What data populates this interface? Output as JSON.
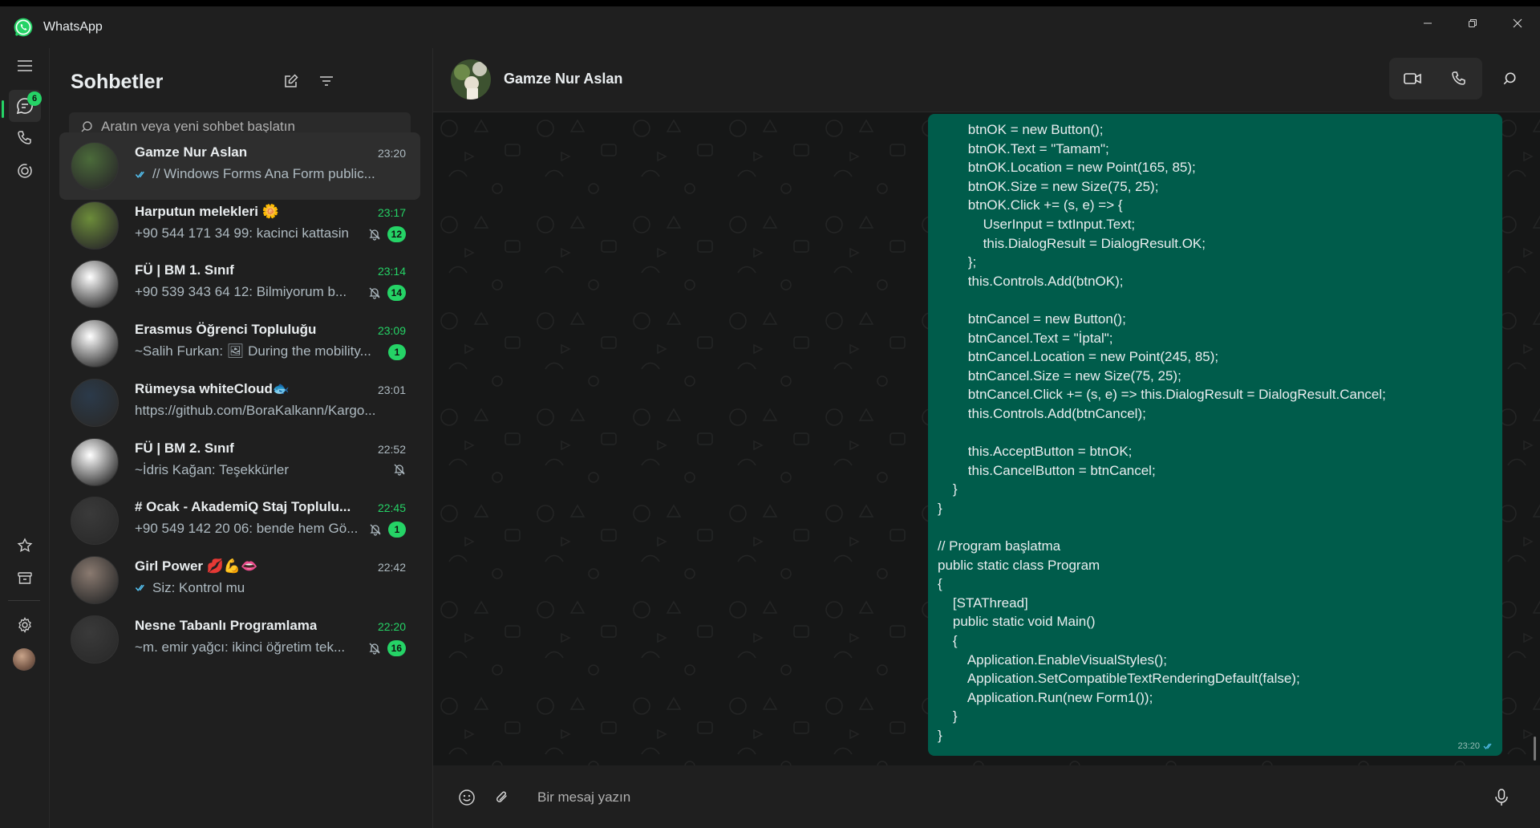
{
  "window": {
    "title": "WhatsApp"
  },
  "rail": {
    "chats_badge": "6"
  },
  "chatlist": {
    "title": "Sohbetler",
    "search_placeholder": "Aratın veya yeni sohbet başlatın",
    "items": [
      {
        "name": "Gamze Nur Aslan",
        "time": "23:20",
        "preview": "// Windows Forms Ana Form public...",
        "read_ticks": true,
        "unread": "",
        "muted": false,
        "time_unread": false,
        "avatar_color": "#4b6b3a"
      },
      {
        "name": "Harputun melekleri 🌼",
        "time": "23:17",
        "preview": "+90 544 171 34 99: kacinci kattasin",
        "read_ticks": false,
        "unread": "12",
        "muted": true,
        "time_unread": true,
        "avatar_color": "#6c8c3a"
      },
      {
        "name": "FÜ | BM 1. Sınıf",
        "time": "23:14",
        "preview": "+90 539 343 64 12: Bilmiyorum b...",
        "read_ticks": false,
        "unread": "14",
        "muted": true,
        "time_unread": true,
        "avatar_color": "#ffffff"
      },
      {
        "name": "Erasmus Öğrenci Topluluğu",
        "time": "23:09",
        "preview": "~Salih Furkan: 🖼 During the mobility...",
        "read_ticks": false,
        "unread": "1",
        "muted": false,
        "time_unread": true,
        "avatar_color": "#ffffff"
      },
      {
        "name": "Rümeysa whiteCloud🐟",
        "time": "23:01",
        "preview": "https://github.com/BoraKalkann/Kargo...",
        "read_ticks": false,
        "unread": "",
        "muted": false,
        "time_unread": false,
        "avatar_color": "#2b3a4a"
      },
      {
        "name": "FÜ | BM 2. Sınıf",
        "time": "22:52",
        "preview": "~İdris Kağan: Teşekkürler",
        "read_ticks": false,
        "unread": "",
        "muted": true,
        "time_unread": false,
        "avatar_color": "#ffffff"
      },
      {
        "name": "# Ocak - AkademiQ Staj Toplulu...",
        "time": "22:45",
        "preview": "+90 549 142 20 06: bende hem Gö...",
        "read_ticks": false,
        "unread": "1",
        "muted": true,
        "time_unread": true,
        "avatar_color": "#3a3a3a"
      },
      {
        "name": "Girl Power 💋💪👄",
        "time": "22:42",
        "preview": "Siz: Kontrol mu",
        "read_ticks": true,
        "unread": "",
        "muted": false,
        "time_unread": false,
        "avatar_color": "#8a7a70"
      },
      {
        "name": "Nesne Tabanlı Programlama",
        "time": "22:20",
        "preview": "~m. emir yağcı: ikinci öğretim tek...",
        "read_ticks": false,
        "unread": "16",
        "muted": true,
        "time_unread": true,
        "avatar_color": "#3a3a3a"
      }
    ]
  },
  "chat": {
    "contact_name": "Gamze Nur Aslan",
    "composer_placeholder": "Bir mesaj yazın",
    "message_time": "23:20",
    "code_lines": [
      "        btnOK = new Button();",
      "        btnOK.Text = \"Tamam\";",
      "        btnOK.Location = new Point(165, 85);",
      "        btnOK.Size = new Size(75, 25);",
      "        btnOK.Click += (s, e) => {",
      "            UserInput = txtInput.Text;",
      "            this.DialogResult = DialogResult.OK;",
      "        };",
      "        this.Controls.Add(btnOK);",
      "",
      "        btnCancel = new Button();",
      "        btnCancel.Text = \"İptal\";",
      "        btnCancel.Location = new Point(245, 85);",
      "        btnCancel.Size = new Size(75, 25);",
      "        btnCancel.Click += (s, e) => this.DialogResult = DialogResult.Cancel;",
      "        this.Controls.Add(btnCancel);",
      "",
      "        this.AcceptButton = btnOK;",
      "        this.CancelButton = btnCancel;",
      "    }",
      "}",
      "",
      "// Program başlatma",
      "public static class Program",
      "{",
      "    [STAThread]",
      "    public static void Main()",
      "    {",
      "        Application.EnableVisualStyles();",
      "        Application.SetCompatibleTextRenderingDefault(false);",
      "        Application.Run(new Form1());",
      "    }",
      "}"
    ]
  },
  "colors": {
    "accent": "#25d366",
    "bubble_out": "#005c4b",
    "panel": "#1f1f1f",
    "chat_bg": "#161717"
  }
}
